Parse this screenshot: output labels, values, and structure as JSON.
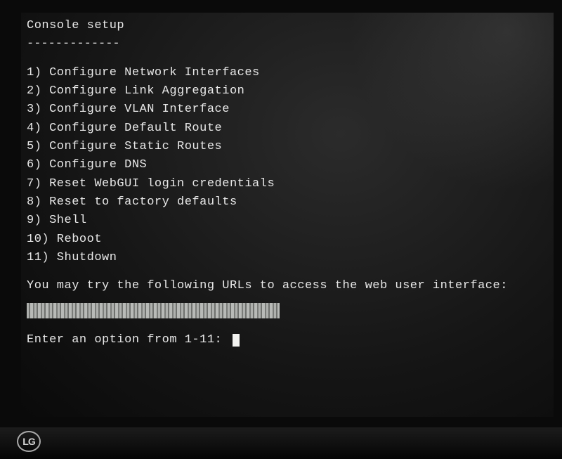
{
  "title": "Console setup",
  "underline": "-------------",
  "menu": [
    {
      "num": "1",
      "label": "Configure Network Interfaces"
    },
    {
      "num": "2",
      "label": "Configure Link Aggregation"
    },
    {
      "num": "3",
      "label": "Configure VLAN Interface"
    },
    {
      "num": "4",
      "label": "Configure Default Route"
    },
    {
      "num": "5",
      "label": "Configure Static Routes"
    },
    {
      "num": "6",
      "label": "Configure DNS"
    },
    {
      "num": "7",
      "label": "Reset WebGUI login credentials"
    },
    {
      "num": "8",
      "label": "Reset to factory defaults"
    },
    {
      "num": "9",
      "label": "Shell"
    },
    {
      "num": "10",
      "label": "Reboot"
    },
    {
      "num": "11",
      "label": "Shutdown"
    }
  ],
  "hint": "You may try the following URLs to access the web user interface:",
  "prompt": "Enter an option from 1-11: ",
  "input_value": "",
  "monitor_brand": "LG"
}
